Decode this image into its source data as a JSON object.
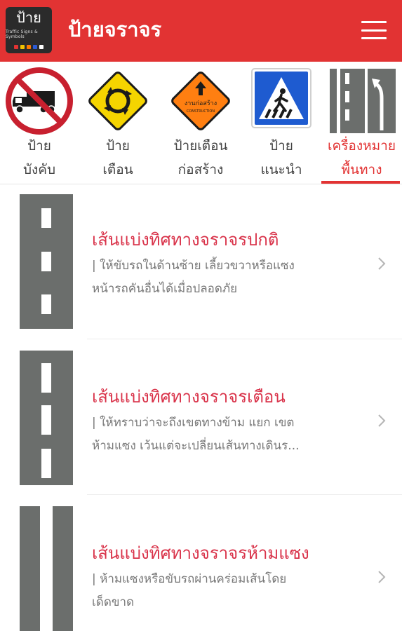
{
  "app": {
    "title": "ป้ายจราจร",
    "logo_text": "ป้าย",
    "logo_subtext": "Traffic Signs & Symbols"
  },
  "colors": {
    "primary": "#e23333",
    "title_red": "#d9334a",
    "road_gray": "#6b6e6c"
  },
  "tabs": [
    {
      "line1": "ป้าย",
      "line2": "บังคับ",
      "icon": "no-truck-sign-icon"
    },
    {
      "line1": "ป้าย",
      "line2": "เตือน",
      "icon": "roundabout-warning-sign-icon"
    },
    {
      "line1": "ป้ายเตือน",
      "line2": "ก่อสร้าง",
      "icon": "construction-warning-sign-icon",
      "sign_text": "งานก่อสร้าง",
      "sign_subtext": "CONSTRUCTION"
    },
    {
      "line1": "ป้าย",
      "line2": "แนะนำ",
      "icon": "pedestrian-crossing-sign-icon"
    },
    {
      "line1": "เครื่องหมาย",
      "line2": "พื้นทาง",
      "icon": "road-marking-icon",
      "active": true
    }
  ],
  "items": [
    {
      "title": "เส้นแบ่งทิศทางจราจรปกติ",
      "desc_line1": "| ให้ขับรถในด้านซ้าย เลี้ยวขวาหรือแซง",
      "desc_line2": "หน้ารถคันอื่นได้เมื่อปลอดภัย",
      "marking": "short-dashed"
    },
    {
      "title": "เส้นแบ่งทิศทางจราจรเตือน",
      "desc_line1": "| ให้ทราบว่าจะถึงเขตทางข้าม แยก เขต",
      "desc_line2": "ห้ามแซง เว้นแต่จะเปลี่ยนเส้นทางเดินร...",
      "marking": "long-dashed"
    },
    {
      "title": "เส้นแบ่งทิศทางจราจรห้ามแซง",
      "desc_line1": "| ห้ามแซงหรือขับรถผ่านคร่อมเส้นโดย",
      "desc_line2": "เด็ดขาด",
      "marking": "solid"
    }
  ]
}
